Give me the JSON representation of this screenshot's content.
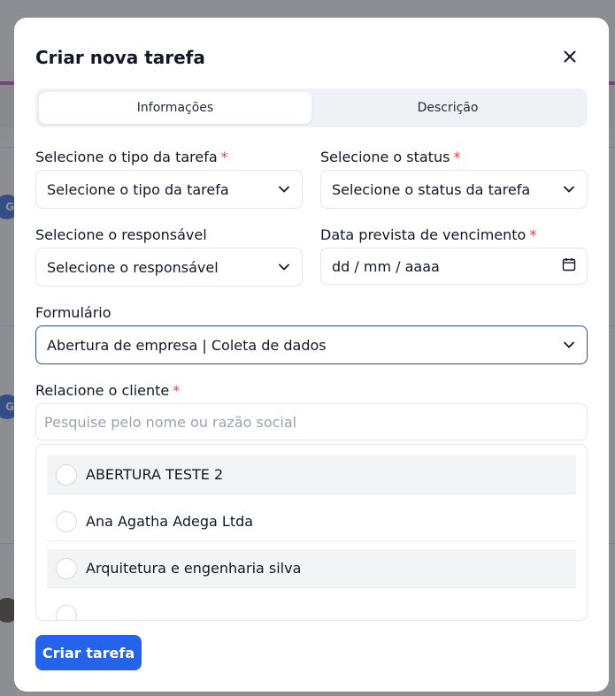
{
  "modal": {
    "title": "Criar nova tarefa"
  },
  "tabs": [
    {
      "label": "Informações",
      "active": true
    },
    {
      "label": "Descrição",
      "active": false
    }
  ],
  "fields": {
    "task_type": {
      "label": "Selecione o tipo da tarefa",
      "required_mark": "*",
      "value": "Selecione o tipo da tarefa"
    },
    "status": {
      "label": "Selecione o status",
      "required_mark": "*",
      "value": "Selecione o status da tarefa"
    },
    "responsible": {
      "label": "Selecione o responsável",
      "value": "Selecione o responsável"
    },
    "due_date": {
      "label": "Data prevista de vencimento",
      "required_mark": "*",
      "value": "dd / mm / aaaa"
    },
    "form": {
      "label": "Formulário",
      "value": "Abertura de empresa | Coleta de dados"
    },
    "client": {
      "label": "Relacione o cliente",
      "required_mark": "*",
      "placeholder": "Pesquise pelo nome ou razão social",
      "options": [
        {
          "label": "ABERTURA TESTE 2"
        },
        {
          "label": "Ana Agatha Adega Ltda"
        },
        {
          "label": "Arquitetura e engenharia silva"
        }
      ]
    }
  },
  "submit_label": "Criar tarefa",
  "background": {
    "avatar_letter": "G"
  },
  "colors": {
    "primary": "#2563eb",
    "required": "#ef4444",
    "focus_border": "#2f4a8f",
    "accent_strip": "#b14ec6"
  },
  "icons": [
    "close-icon",
    "chevron-down-icon",
    "calendar-icon"
  ]
}
